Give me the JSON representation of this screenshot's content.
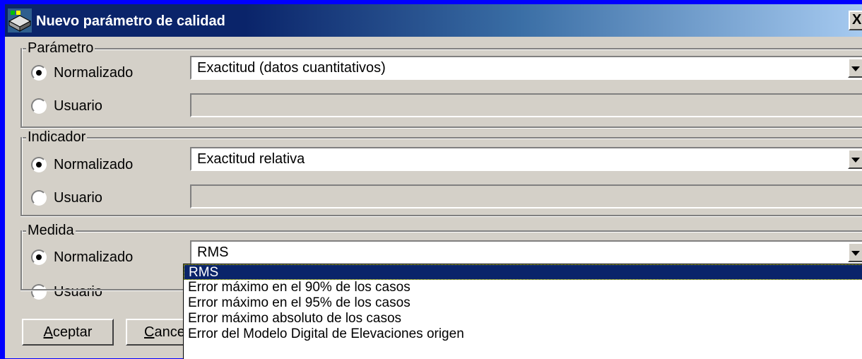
{
  "window": {
    "title": "Nuevo parámetro de calidad",
    "close_label": "X"
  },
  "parametro": {
    "legend": "Parámetro",
    "normalizado_label": "Normalizado",
    "usuario_label": "Usuario",
    "selected": "normalizado",
    "combo_value": "Exactitud (datos cuantitativos)",
    "usuario_value": ""
  },
  "indicador": {
    "legend": "Indicador",
    "normalizado_label": "Normalizado",
    "usuario_label": "Usuario",
    "selected": "normalizado",
    "combo_value": "Exactitud relativa",
    "usuario_value": ""
  },
  "medida": {
    "legend": "Medida",
    "normalizado_label": "Normalizado",
    "usuario_label": "Usuario",
    "selected": "normalizado",
    "combo_value": "RMS",
    "dropdown_options": [
      "RMS",
      "Error máximo en el 90% de los casos",
      "Error máximo en el 95% de los casos",
      "Error máximo absoluto de los casos",
      "Error del Modelo Digital de Elevaciones origen"
    ],
    "dropdown_selected_index": 0
  },
  "buttons": {
    "accept_mnemonic": "A",
    "accept_rest": "ceptar",
    "cancel_mnemonic": "C",
    "cancel_rest": "ance"
  },
  "colors": {
    "face": "#d4d0c8",
    "title_active": "#0a246a",
    "desktop": "#0000ff"
  },
  "icons": {
    "app": "map-icon",
    "close": "close-icon",
    "dropdown": "chevron-down-icon"
  }
}
